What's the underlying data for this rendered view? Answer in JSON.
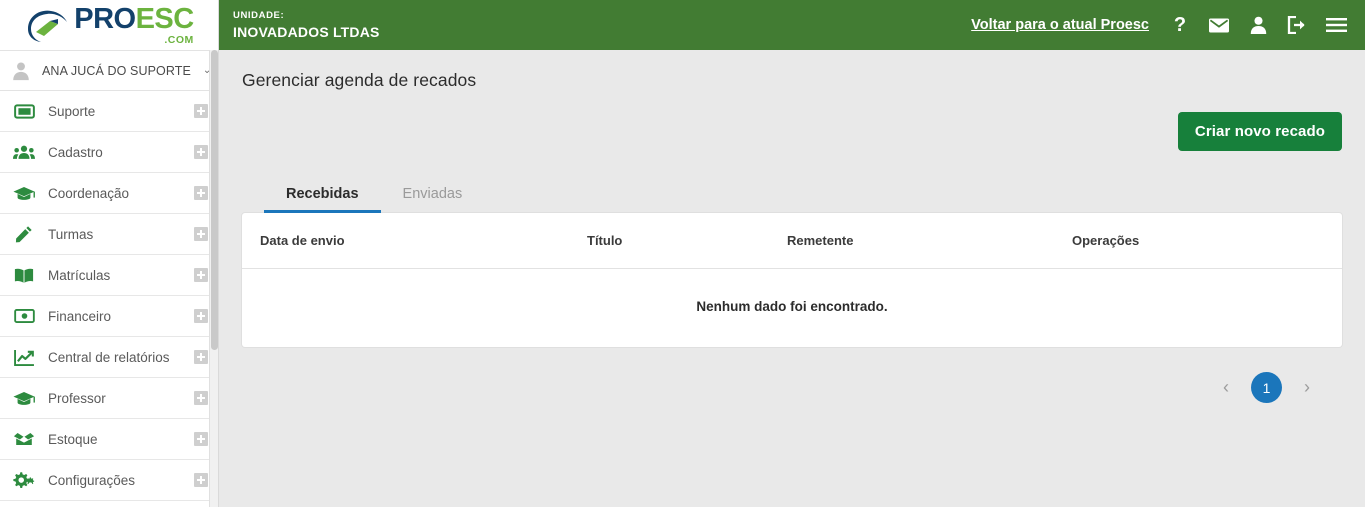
{
  "brand": {
    "logo_pro": "PRO",
    "logo_esc": "ESC",
    "logo_com": ".COM",
    "colors": {
      "header_green": "#427c33",
      "button_green": "#17803b",
      "accent_blue": "#1b76bb",
      "logo_navy": "#13416b",
      "logo_green": "#6cb33f"
    }
  },
  "sidebar": {
    "user": {
      "name": "ANA JUCÁ DO SUPORTE",
      "caret": "⌄"
    },
    "items": [
      {
        "label": "Suporte",
        "icon": "ticket-icon",
        "expand": "plus-icon"
      },
      {
        "label": "Cadastro",
        "icon": "users-icon",
        "expand": "plus-icon"
      },
      {
        "label": "Coordenação",
        "icon": "graduation-cap-icon",
        "expand": "plus-icon"
      },
      {
        "label": "Turmas",
        "icon": "pencil-icon",
        "expand": "plus-icon"
      },
      {
        "label": "Matrículas",
        "icon": "book-open-icon",
        "expand": "plus-icon"
      },
      {
        "label": "Financeiro",
        "icon": "money-bill-icon",
        "expand": "plus-icon"
      },
      {
        "label": "Central de relatórios",
        "icon": "chart-line-icon",
        "expand": "plus-icon"
      },
      {
        "label": "Professor",
        "icon": "graduation-cap-icon",
        "expand": "plus-icon"
      },
      {
        "label": "Estoque",
        "icon": "box-open-icon",
        "expand": "plus-icon"
      },
      {
        "label": "Configurações",
        "icon": "cogs-icon",
        "expand": "plus-icon"
      }
    ]
  },
  "topbar": {
    "unit_label": "UNIDADE:",
    "unit_name": "INOVADADOS LTDAS",
    "back_link": "Voltar para o atual Proesc",
    "icons": [
      {
        "name": "help-icon",
        "glyph": "?"
      },
      {
        "name": "envelope-icon",
        "glyph": "✉"
      },
      {
        "name": "user-icon",
        "glyph": "👤"
      },
      {
        "name": "sign-out-icon",
        "glyph": "⇥"
      },
      {
        "name": "hamburger-menu-icon",
        "glyph": "☰"
      }
    ]
  },
  "main": {
    "page_title": "Gerenciar agenda de recados",
    "create_button": "Criar novo recado",
    "tabs": [
      {
        "label": "Recebidas",
        "active": true
      },
      {
        "label": "Enviadas",
        "active": false
      }
    ],
    "table": {
      "columns": [
        "Data de envio",
        "Título",
        "Remetente",
        "Operações"
      ],
      "rows": [],
      "empty_message": "Nenhum dado foi encontrado."
    },
    "pagination": {
      "prev": "‹",
      "next": "›",
      "pages": [
        "1"
      ],
      "current": "1"
    }
  }
}
